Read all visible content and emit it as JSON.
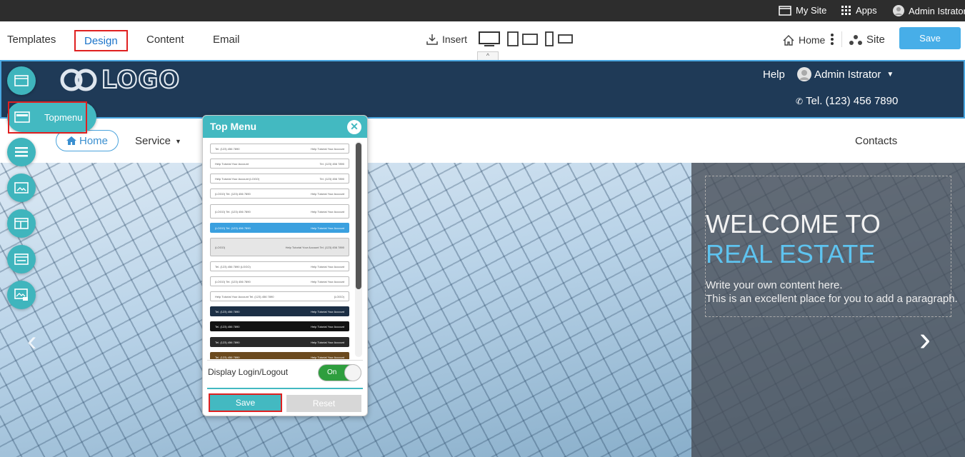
{
  "topbar": {
    "my_site": "My Site",
    "apps": "Apps",
    "user": "Admin Istrator"
  },
  "toolbar": {
    "tabs": [
      "Templates",
      "Design",
      "Content",
      "Email"
    ],
    "insert": "Insert",
    "home": "Home",
    "site": "Site",
    "save": "Save"
  },
  "header": {
    "logo": "LOGO",
    "help": "Help",
    "user": "Admin Istrator",
    "phone": "Tel. (123) 456 7890"
  },
  "nav": {
    "home": "Home",
    "service": "Service",
    "contacts": "Contacts"
  },
  "hero": {
    "title_line1": "WELCOME TO",
    "title_line2": "REAL ESTATE",
    "para1": "Write your own content here.",
    "para2": "This is an excellent place for you to add a paragraph."
  },
  "sidebar": {
    "topmenu_label": "Topmenu"
  },
  "panel": {
    "title": "Top Menu",
    "toggle_label": "Display Login/Logout",
    "toggle_value": "On",
    "save": "Save",
    "reset": "Reset",
    "options": [
      {
        "left": "Tel. (123) 456 7890",
        "right": "Help   Tutorial   Your Account"
      },
      {
        "left": "Help   Tutorial   Your Account",
        "right": "Tel. (123) 456 7890"
      },
      {
        "left": "Help   Tutorial   Your Account   (LOGO)",
        "right": "Tel. (123) 456 7890"
      },
      {
        "left": "(LOGO)   Tel. (123) 456 7890",
        "right": "Help   Tutorial   Your Account"
      },
      {
        "left": "(LOGO)   Tel. (123) 456 7890",
        "right": "Help   Tutorial   Your Account"
      },
      {
        "left": "(LOGO)   Tel. (123) 456 7890",
        "right": "Help   Tutorial   Your Account"
      },
      {
        "left": "(LOGO)",
        "right": "Help   Tutorial   Your Account   Tel. (123) 456 7890"
      },
      {
        "left": "Tel. (123) 456 7890   (LOGO)",
        "right": "Help   Tutorial   Your Account"
      },
      {
        "left": "(LOGO)   Tel. (123) 456 7890",
        "right": "Help   Tutorial   Your Account"
      },
      {
        "left": "Help   Tutorial   Your Account   Tel. (123) 456 7890",
        "right": "(LOGO)"
      },
      {
        "left": "Tel. (123) 456 7890",
        "right": "Help   Tutorial   Your Account"
      },
      {
        "left": "Tel. (123) 456 7890",
        "right": "Help   Tutorial   Your Account"
      },
      {
        "left": "Tel. (123) 456 7890",
        "right": "Help   Tutorial   Your Account"
      },
      {
        "left": "Tel. (123) 456 7890",
        "right": "Help   Tutorial   Your Account"
      }
    ]
  }
}
